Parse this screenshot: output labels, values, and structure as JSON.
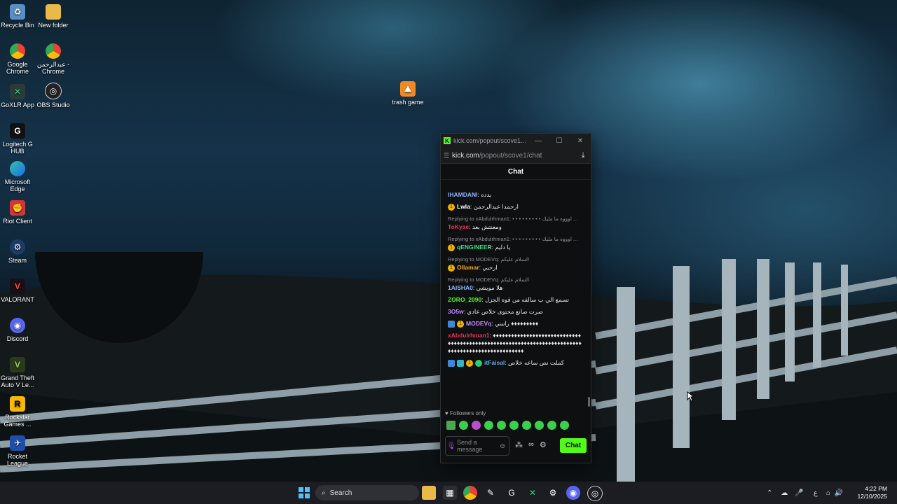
{
  "desktop": {
    "icons": [
      {
        "label": "Recycle Bin",
        "icon": "recycle-bin-icon"
      },
      {
        "label": "New folder",
        "icon": "folder-icon"
      },
      {
        "label": "Google Chrome",
        "icon": "chrome-icon"
      },
      {
        "label": "عبدالرحمن - Chrome",
        "icon": "chrome-profile-icon"
      },
      {
        "label": "GoXLR App",
        "icon": "goxlr-icon"
      },
      {
        "label": "OBS Studio",
        "icon": "obs-icon"
      },
      {
        "label": "Logitech G HUB",
        "icon": "logitech-icon"
      },
      {
        "label": "Microsoft Edge",
        "icon": "edge-icon"
      },
      {
        "label": "Riot Client",
        "icon": "riot-icon"
      },
      {
        "label": "Steam",
        "icon": "steam-icon"
      },
      {
        "label": "VALORANT",
        "icon": "valorant-icon"
      },
      {
        "label": "Discord",
        "icon": "discord-icon"
      },
      {
        "label": "Grand Theft Auto V Le...",
        "icon": "gta-icon"
      },
      {
        "label": "Rockstar Games ...",
        "icon": "rockstar-icon"
      },
      {
        "label": "Rocket League",
        "icon": "rocket-league-icon"
      },
      {
        "label": "trash game",
        "icon": "trash-game-icon"
      }
    ]
  },
  "window": {
    "title": "kick.com/popout/scove1/ch...",
    "url_host": "kick.com",
    "url_path": "/popout/scove1/chat",
    "header": "Chat"
  },
  "chat": {
    "messages": [
      {
        "user": "IHAMDANI",
        "text": "بدده",
        "color": "#8fb4ff"
      },
      {
        "user": "Lwla",
        "text": "ارحمدا عبدالرحمن",
        "color": "#ffffff",
        "badge": "1"
      },
      {
        "reply": "Replying to xAbdulrhman1: • • • • • • • • • اوووه ما مليك ...",
        "user": "ToKyae",
        "text": "ومعنتش بعد",
        "color": "#e8325a"
      },
      {
        "reply": "Replying to xAbdulrhman1: • • • • • • • • • اوووه ما مليك ...",
        "user": "qENGINEER",
        "text": "يا دليم",
        "color": "#3ddc8a",
        "badge": "1"
      },
      {
        "reply": "Replying to MODEVq: السلام عليكم",
        "user": "Ollamar",
        "text": "ارحبي",
        "color": "#f5a623",
        "badge": "1"
      },
      {
        "reply": "Replying to MODEVq: السلام عليكم",
        "user": "1AISHA0",
        "text": "هلا مويشي",
        "color": "#8fb4ff"
      },
      {
        "user": "ZORO_2090",
        "text": "تسمع الي ب سالفه من قوه الجزل",
        "color": "#53fc18"
      },
      {
        "user": "3O5w",
        "text": "صرت صانع محتوى خلاص عادي",
        "color": "#c688ff"
      },
      {
        "user": "MODEVq",
        "text": "راسي ♦♦♦♦♦♦♦♦♦",
        "color": "#c688ff",
        "badge": "1",
        "mod": true
      },
      {
        "user": "xAbdulrhman1",
        "text": "♦♦♦♦♦♦♦♦♦♦♦♦♦♦♦♦♦♦♦♦♦♦♦♦♦♦♦♦♦♦♦♦♦♦♦♦♦♦♦♦♦♦♦♦♦♦♦♦♦♦♦♦♦♦♦♦♦♦♦♦♦♦♦♦♦♦♦♦♦♦♦♦♦♦♦♦♦♦♦♦♦♦♦♦♦♦♦♦♦♦♦♦♦♦♦♦♦♦",
        "color": "#e8325a"
      },
      {
        "user": "itFaisal",
        "text": "كملت نص ساعه خلاص",
        "color": "#5dade2",
        "badge": "1",
        "mod": true
      }
    ],
    "followers_only": "Followers only",
    "input_placeholder": "Send a message",
    "send_label": "Chat"
  },
  "taskbar": {
    "search_label": "Search",
    "lang": "ع",
    "time": "4:22 PM",
    "date": "12/10/2025"
  }
}
